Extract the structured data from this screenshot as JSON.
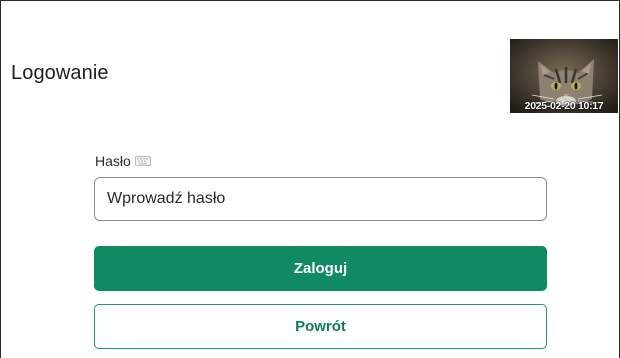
{
  "header": {
    "title": "Logowanie"
  },
  "camera": {
    "icon": "camera-snapshot-cat",
    "timestamp": "2025-02-20 10:17"
  },
  "form": {
    "password_label": "Hasło",
    "password_label_icon": "keyboard-icon",
    "password_value": "",
    "password_placeholder": "Wprowadź hasło",
    "login_label": "Zaloguj",
    "back_label": "Powrót"
  },
  "colors": {
    "primary": "#0f8a63",
    "primary_text": "#ffffff",
    "secondary_border": "#1a9a71",
    "secondary_text": "#0f7e5b"
  }
}
